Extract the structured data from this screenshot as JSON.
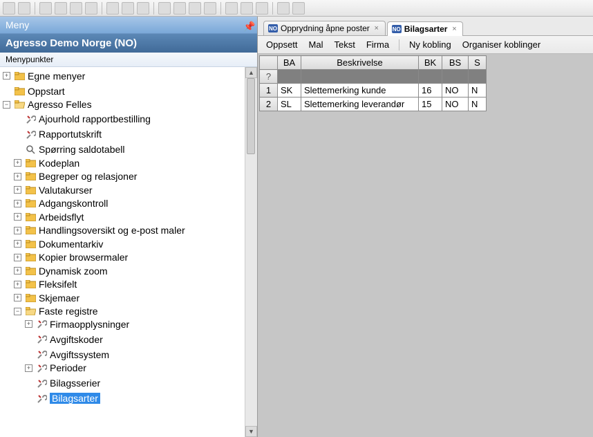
{
  "left": {
    "title": "Meny",
    "subtitle": "Agresso Demo Norge (NO)",
    "section": "Menypunkter"
  },
  "tree": {
    "n0": "Egne menyer",
    "n1": "Oppstart",
    "n2": "Agresso Felles",
    "n2_0": "Ajourhold rapportbestilling",
    "n2_1": "Rapportutskrift",
    "n2_2": "Spørring saldotabell",
    "n2_3": "Kodeplan",
    "n2_4": "Begreper og relasjoner",
    "n2_5": "Valutakurser",
    "n2_6": "Adgangskontroll",
    "n2_7": "Arbeidsflyt",
    "n2_8": "Handlingsoversikt og e-post maler",
    "n2_9": "Dokumentarkiv",
    "n2_10": "Kopier browsermaler",
    "n2_11": "Dynamisk zoom",
    "n2_12": "Fleksifelt",
    "n2_13": "Skjemaer",
    "n2_14": "Faste registre",
    "n2_14_0": "Firmaopplysninger",
    "n2_14_1": "Avgiftskoder",
    "n2_14_2": "Avgiftssystem",
    "n2_14_3": "Perioder",
    "n2_14_4": "Bilagsserier",
    "n2_14_5": "Bilagsarter"
  },
  "tabs": [
    {
      "icon": "NO",
      "label": "Opprydning åpne poster",
      "active": false
    },
    {
      "icon": "NO",
      "label": "Bilagsarter",
      "active": true
    }
  ],
  "menu": {
    "m0": "Oppsett",
    "m1": "Mal",
    "m2": "Tekst",
    "m3": "Firma",
    "m4": "Ny kobling",
    "m5": "Organiser koblinger"
  },
  "grid": {
    "headers": {
      "rownum": "",
      "ba": "BA",
      "besk": "Beskrivelse",
      "bk": "BK",
      "bs": "BS",
      "s": "S"
    },
    "filterMark": "?",
    "rows": [
      {
        "num": "1",
        "ba": "SK",
        "besk": "Slettemerking kunde",
        "bk": "16",
        "bs": "NO",
        "s": "N"
      },
      {
        "num": "2",
        "ba": "SL",
        "besk": "Slettemerking leverandør",
        "bk": "15",
        "bs": "NO",
        "s": "N"
      }
    ]
  }
}
